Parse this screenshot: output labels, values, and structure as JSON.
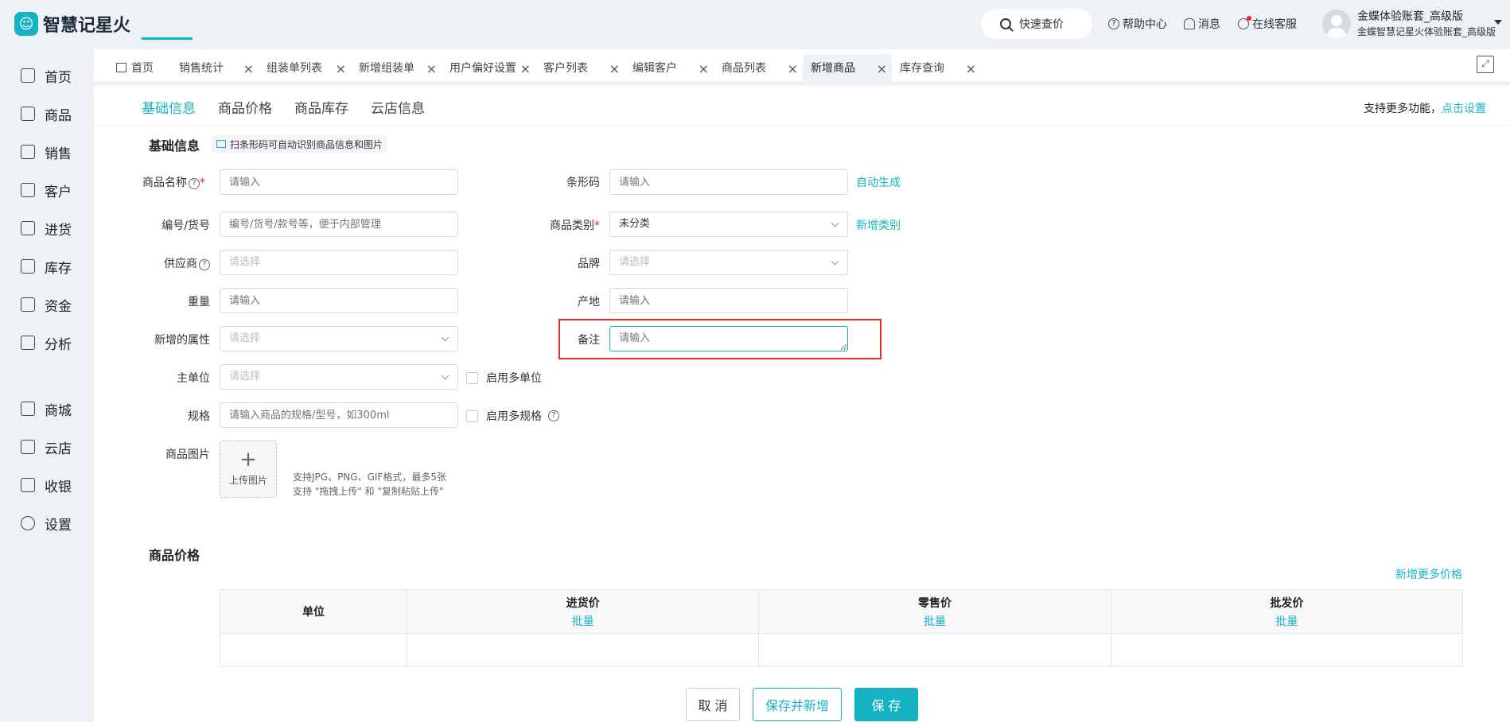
{
  "app": {
    "logo_mark": "☺",
    "logo_text": "智慧记星火"
  },
  "header": {
    "quick_query": "快速查价",
    "help": "帮助中心",
    "messages": "消息",
    "service": "在线客服",
    "user_name": "金蝶体验账套_高级版",
    "user_sub": "金蝶智慧记星火体验账套_高级版"
  },
  "sidebar": {
    "items": [
      {
        "label": "首页",
        "icon": "home-icon"
      },
      {
        "label": "商品",
        "icon": "product-icon"
      },
      {
        "label": "销售",
        "icon": "sales-icon"
      },
      {
        "label": "客户",
        "icon": "customer-icon"
      },
      {
        "label": "进货",
        "icon": "purchase-icon"
      },
      {
        "label": "库存",
        "icon": "stock-icon"
      },
      {
        "label": "资金",
        "icon": "fund-icon"
      },
      {
        "label": "分析",
        "icon": "analysis-icon"
      },
      {
        "label": "商城",
        "icon": "mall-icon"
      },
      {
        "label": "云店",
        "icon": "cloud-store-icon"
      },
      {
        "label": "收银",
        "icon": "cashier-icon"
      },
      {
        "label": "设置",
        "icon": "settings-icon"
      }
    ]
  },
  "tabs": [
    {
      "label": "首页"
    },
    {
      "label": "销售统计"
    },
    {
      "label": "组装单列表"
    },
    {
      "label": "新增组装单"
    },
    {
      "label": "用户偏好设置"
    },
    {
      "label": "客户列表"
    },
    {
      "label": "编辑客户"
    },
    {
      "label": "商品列表"
    },
    {
      "label": "新增商品",
      "active": true
    },
    {
      "label": "库存查询"
    }
  ],
  "subtabs": [
    "基础信息",
    "商品价格",
    "商品库存",
    "云店信息"
  ],
  "more_func": {
    "text": "支持更多功能，",
    "link": "点击设置"
  },
  "basic": {
    "title": "基础信息",
    "scan_tip": "扫条形码可自动识别商品信息和图片",
    "name_label": "商品名称",
    "name_placeholder": "请输入",
    "code_label": "编号/货号",
    "code_placeholder": "编号/货号/款号等，便于内部管理",
    "supplier_label": "供应商",
    "supplier_placeholder": "请选择",
    "weight_label": "重量",
    "weight_placeholder": "请输入",
    "attr_label": "新增的属性",
    "attr_placeholder": "请选择",
    "unit_label": "主单位",
    "unit_placeholder": "请选择",
    "multi_unit": "启用多单位",
    "spec_label": "规格",
    "spec_placeholder": "请输入商品的规格/型号，如300ml",
    "multi_spec": "启用多规格",
    "barcode_label": "条形码",
    "barcode_placeholder": "请输入",
    "auto_gen": "自动生成",
    "category_label": "商品类别",
    "category_value": "未分类",
    "new_category": "新增类别",
    "brand_label": "品牌",
    "brand_placeholder": "请选择",
    "origin_label": "产地",
    "origin_placeholder": "请输入",
    "remark_label": "备注",
    "remark_placeholder": "请输入",
    "image_label": "商品图片",
    "upload_label": "上传图片",
    "upload_tip1": "支持JPG、PNG、GIF格式，最多5张",
    "upload_tip2": "支持 \"拖拽上传\" 和 \"复制粘贴上传\""
  },
  "price": {
    "title": "商品价格",
    "add_more": "新增更多价格",
    "columns": [
      "单位",
      "进货价",
      "零售价",
      "批发价"
    ],
    "batch": "批量"
  },
  "actions": {
    "cancel": "取 消",
    "save_new": "保存并新增",
    "save": "保 存"
  }
}
